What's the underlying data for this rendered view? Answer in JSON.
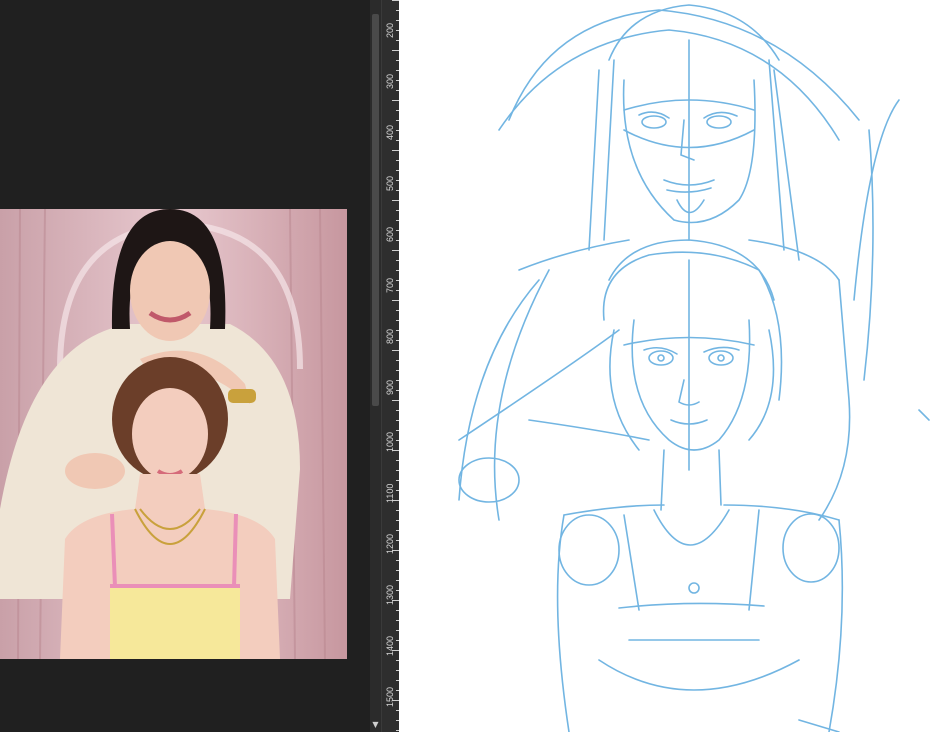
{
  "app": {
    "reference_panel": {
      "photo_alt": "Reference photo of two women posing in front of pink curtains"
    },
    "ruler": {
      "labels": [
        "200",
        "300",
        "400",
        "500",
        "600",
        "700",
        "800",
        "900",
        "1000",
        "1100",
        "1200",
        "1300",
        "1400",
        "1500"
      ]
    },
    "canvas": {
      "sketch_desc": "Blue pencil sketch of two stacked portraits"
    },
    "colors": {
      "ui_background": "#202020",
      "ruler_background": "#2e2e2e",
      "sketch_line": "#5aa9dd",
      "canvas": "#ffffff"
    }
  }
}
